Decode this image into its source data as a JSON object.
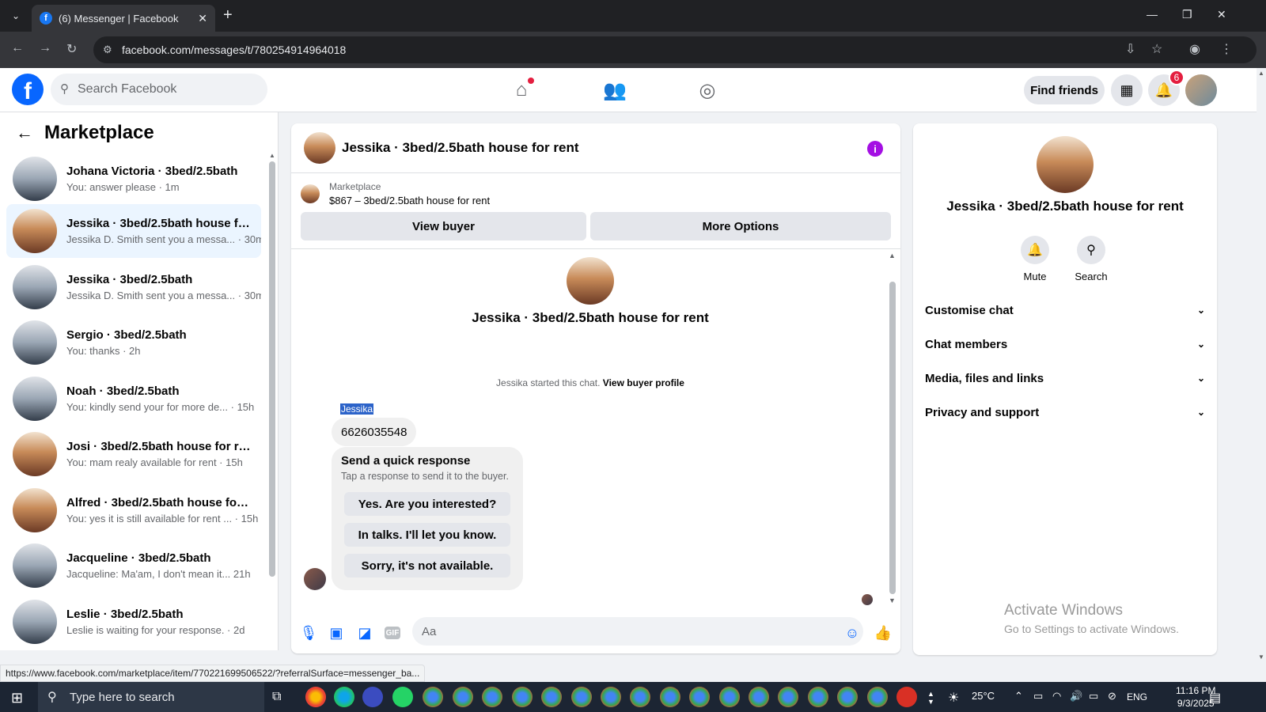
{
  "browser": {
    "tab_title": "(6) Messenger | Facebook",
    "url": "facebook.com/messages/t/780254914964018",
    "status_link": "https://www.facebook.com/marketplace/item/770221699506522/?referralSurface=messenger_ba..."
  },
  "header": {
    "search_placeholder": "Search Facebook",
    "find_friends": "Find friends",
    "notification_count": "6"
  },
  "sidebar": {
    "title": "Marketplace",
    "conversations": [
      {
        "name": "Johana Victoria · 3bed/2.5bath",
        "preview": "You: answer please · 1m"
      },
      {
        "name": "Jessika · 3bed/2.5bath house for...",
        "preview": "Jessika D. Smith sent you a messa... · 30m"
      },
      {
        "name": "Jessika · 3bed/2.5bath",
        "preview": "Jessika D. Smith sent you a messa... · 30m"
      },
      {
        "name": "Sergio · 3bed/2.5bath",
        "preview": "You: thanks · 2h"
      },
      {
        "name": "Noah · 3bed/2.5bath",
        "preview": "You: kindly send your for more de... · 15h"
      },
      {
        "name": "Josi · 3bed/2.5bath house for rent",
        "preview": "You: mam realy available for rent · 15h"
      },
      {
        "name": "Alfred · 3bed/2.5bath house for ...",
        "preview": "You: yes it is still available for rent ... · 15h"
      },
      {
        "name": "Jacqueline · 3bed/2.5bath",
        "preview": "Jacqueline: Ma'am, I don't mean it... 21h"
      },
      {
        "name": "Leslie · 3bed/2.5bath",
        "preview": "Leslie is waiting for your response. · 2d"
      }
    ]
  },
  "chat": {
    "title": "Jessika · 3bed/2.5bath house for rent",
    "marketplace_label": "Marketplace",
    "listing": "$867 – 3bed/2.5bath house for rent",
    "view_buyer": "View buyer",
    "more_options": "More Options",
    "started_text": "Jessika started this chat.",
    "view_buyer_profile": "View buyer profile",
    "sender": "Jessika",
    "message": "6626035548",
    "quick_title": "Send a quick response",
    "quick_sub": "Tap a response to send it to the buyer.",
    "quick_responses": [
      "Yes. Are you interested?",
      "In talks. I'll let you know.",
      "Sorry, it's not available."
    ],
    "input_placeholder": "Aa"
  },
  "right_panel": {
    "name": "Jessika · 3bed/2.5bath house for rent",
    "mute": "Mute",
    "search": "Search",
    "sections": [
      "Customise chat",
      "Chat members",
      "Media, files and links",
      "Privacy and support"
    ],
    "watermark_title": "Activate Windows",
    "watermark_sub": "Go to Settings to activate Windows."
  },
  "taskbar": {
    "search_placeholder": "Type here to search",
    "temperature": "25°C",
    "language": "ENG",
    "time": "11:16 PM",
    "date": "9/3/2025"
  }
}
